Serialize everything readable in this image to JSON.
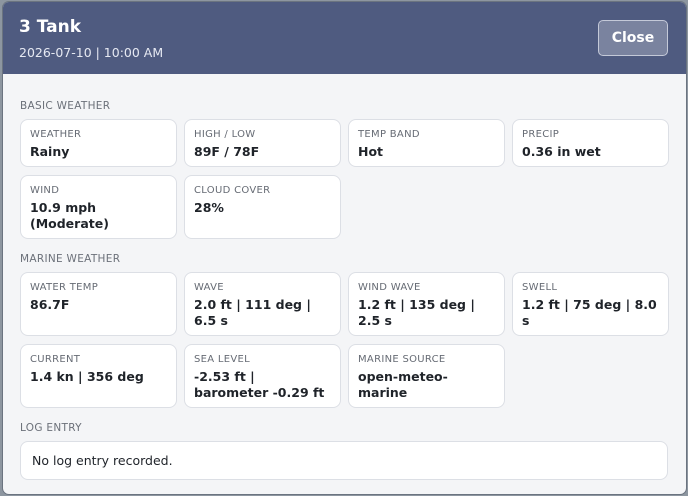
{
  "header": {
    "title": "3 Tank",
    "datetime": "2026-07-10 | 10:00 AM",
    "close_label": "Close"
  },
  "basic_weather": {
    "section_label": "BASIC WEATHER",
    "cards": [
      {
        "label": "WEATHER",
        "value": "Rainy"
      },
      {
        "label": "HIGH / LOW",
        "value": "89F / 78F"
      },
      {
        "label": "TEMP BAND",
        "value": "Hot"
      },
      {
        "label": "PRECIP",
        "value": "0.36 in wet"
      },
      {
        "label": "WIND",
        "value": "10.9 mph (Moderate)"
      },
      {
        "label": "CLOUD COVER",
        "value": "28%"
      }
    ]
  },
  "marine_weather": {
    "section_label": "MARINE WEATHER",
    "cards": [
      {
        "label": "WATER TEMP",
        "value": "86.7F"
      },
      {
        "label": "WAVE",
        "value": "2.0 ft | 111 deg | 6.5 s"
      },
      {
        "label": "WIND WAVE",
        "value": "1.2 ft | 135 deg | 2.5 s"
      },
      {
        "label": "SWELL",
        "value": "1.2 ft | 75 deg | 8.0 s"
      },
      {
        "label": "CURRENT",
        "value": "1.4 kn | 356 deg"
      },
      {
        "label": "SEA LEVEL",
        "value": "-2.53 ft | barometer -0.29 ft"
      },
      {
        "label": "MARINE SOURCE",
        "value": "open-meteo-marine"
      }
    ]
  },
  "log_entry": {
    "section_label": "LOG ENTRY",
    "text": "No log entry recorded."
  }
}
